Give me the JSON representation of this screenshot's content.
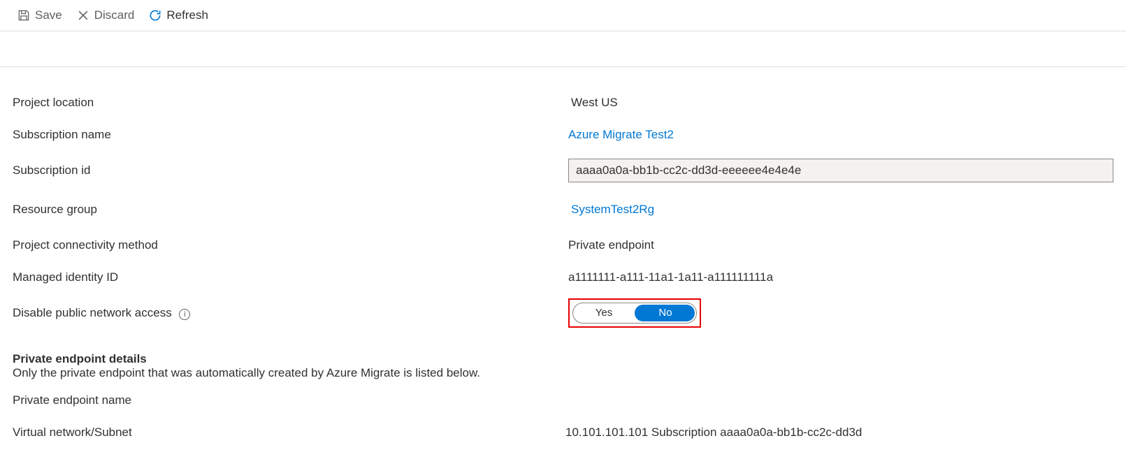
{
  "toolbar": {
    "save": "Save",
    "discard": "Discard",
    "refresh": "Refresh"
  },
  "rows": {
    "project_location": {
      "label": "Project location",
      "value": "West US"
    },
    "subscription_name": {
      "label": "Subscription name",
      "value": "Azure Migrate Test2"
    },
    "subscription_id": {
      "label": "Subscription id",
      "value": "aaaa0a0a-bb1b-cc2c-dd3d-eeeeee4e4e4e"
    },
    "resource_group": {
      "label": "Resource group",
      "value": "SystemTest2Rg"
    },
    "connectivity_method": {
      "label": "Project connectivity method",
      "value": "Private endpoint"
    },
    "managed_identity_id": {
      "label": "Managed identity ID",
      "value": "a1111111-a111-11a1-1a11-a111111111a"
    },
    "disable_public_access": {
      "label": "Disable public network access",
      "yes": "Yes",
      "no": "No"
    }
  },
  "private_endpoint": {
    "title": "Private endpoint details",
    "desc": "Only the private endpoint that was automatically created by Azure Migrate is listed below.",
    "name_label": "Private endpoint name",
    "vnet_label": "Virtual network/Subnet",
    "vnet_value": "10.101.101.101 Subscription aaaa0a0a-bb1b-cc2c-dd3d"
  }
}
